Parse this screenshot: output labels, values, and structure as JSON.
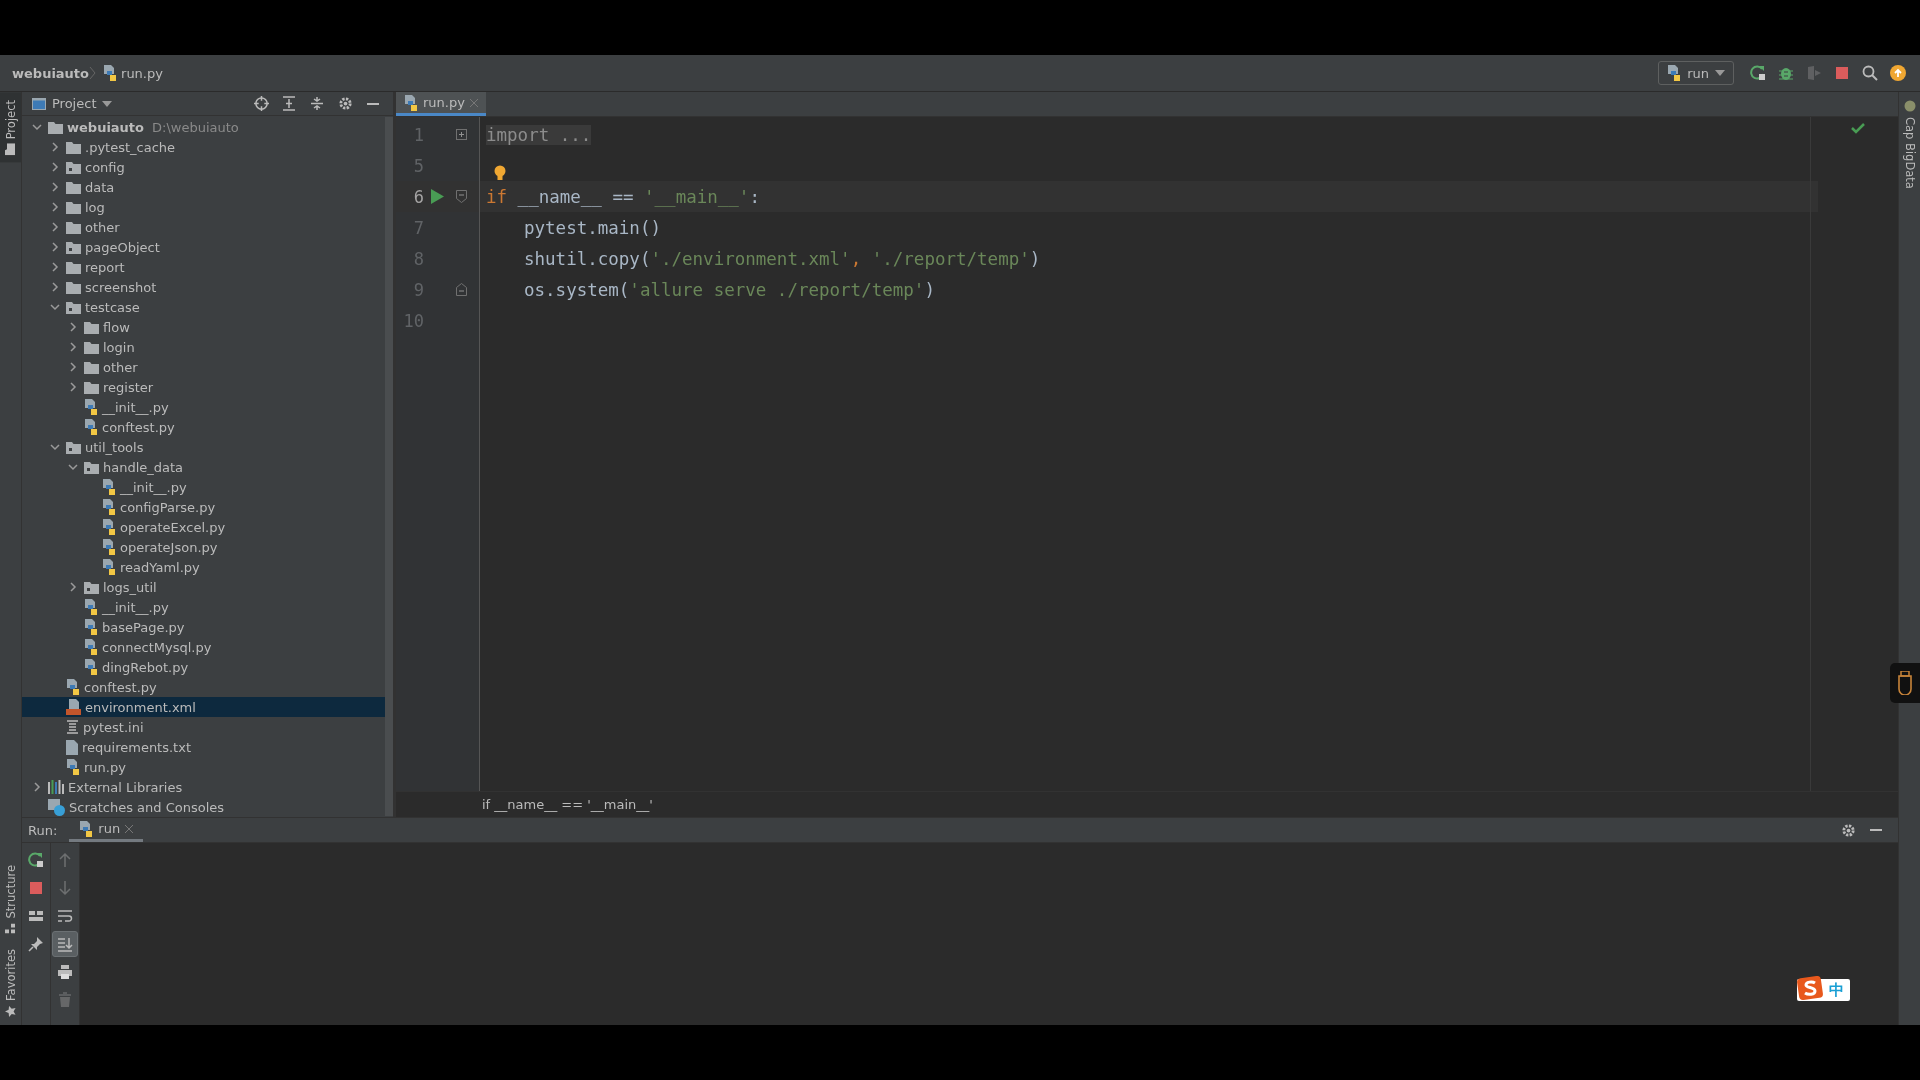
{
  "navbar": {
    "breadcrumb": [
      {
        "label": "webuiauto",
        "kind": "project"
      },
      {
        "label": "run.py",
        "kind": "python"
      }
    ],
    "run_config": "run",
    "actions": [
      {
        "kind": "rerun",
        "disabled": false
      },
      {
        "kind": "debug",
        "disabled": false
      },
      {
        "kind": "coverage",
        "disabled": true
      },
      {
        "kind": "stop",
        "disabled": false
      },
      {
        "kind": "search",
        "disabled": false
      },
      {
        "kind": "update",
        "disabled": false
      }
    ]
  },
  "left_stripe": {
    "top": [
      {
        "label": "Project",
        "selected": true
      }
    ],
    "bottom": [
      {
        "label": "Structure",
        "selected": false
      },
      {
        "label": "Favorites",
        "selected": false
      }
    ]
  },
  "project_panel": {
    "title": "Project",
    "tree": [
      {
        "label": "webuiauto",
        "kind": "folder",
        "expanded": true,
        "selected": false,
        "path": "D:\\webuiauto",
        "children": [
          {
            "label": ".pytest_cache",
            "kind": "folder",
            "expanded": false,
            "selected": false
          },
          {
            "label": "config",
            "kind": "package",
            "expanded": false,
            "selected": false
          },
          {
            "label": "data",
            "kind": "folder",
            "expanded": false,
            "selected": false
          },
          {
            "label": "log",
            "kind": "folder",
            "expanded": false,
            "selected": false
          },
          {
            "label": "other",
            "kind": "folder",
            "expanded": false,
            "selected": false
          },
          {
            "label": "pageObject",
            "kind": "package",
            "expanded": false,
            "selected": false
          },
          {
            "label": "report",
            "kind": "folder",
            "expanded": false,
            "selected": false
          },
          {
            "label": "screenshot",
            "kind": "folder",
            "expanded": false,
            "selected": false
          },
          {
            "label": "testcase",
            "kind": "package",
            "expanded": true,
            "selected": false,
            "children": [
              {
                "label": "flow",
                "kind": "folder",
                "expanded": false,
                "selected": false
              },
              {
                "label": "login",
                "kind": "folder",
                "expanded": false,
                "selected": false
              },
              {
                "label": "other",
                "kind": "folder",
                "expanded": false,
                "selected": false
              },
              {
                "label": "register",
                "kind": "folder",
                "expanded": false,
                "selected": false
              },
              {
                "label": "__init__.py",
                "kind": "python",
                "selected": false
              },
              {
                "label": "conftest.py",
                "kind": "python",
                "selected": false
              }
            ]
          },
          {
            "label": "util_tools",
            "kind": "package",
            "expanded": true,
            "selected": false,
            "children": [
              {
                "label": "handle_data",
                "kind": "package",
                "expanded": true,
                "selected": false,
                "children": [
                  {
                    "label": "__init__.py",
                    "kind": "python",
                    "selected": false
                  },
                  {
                    "label": "configParse.py",
                    "kind": "python",
                    "selected": false
                  },
                  {
                    "label": "operateExcel.py",
                    "kind": "python",
                    "selected": false
                  },
                  {
                    "label": "operateJson.py",
                    "kind": "python",
                    "selected": false
                  },
                  {
                    "label": "readYaml.py",
                    "kind": "python",
                    "selected": false
                  }
                ]
              },
              {
                "label": "logs_util",
                "kind": "package",
                "expanded": false,
                "selected": false
              },
              {
                "label": "__init__.py",
                "kind": "python",
                "selected": false
              },
              {
                "label": "basePage.py",
                "kind": "python",
                "selected": false
              },
              {
                "label": "connectMysql.py",
                "kind": "python",
                "selected": false
              },
              {
                "label": "dingRebot.py",
                "kind": "python",
                "selected": false
              }
            ]
          },
          {
            "label": "conftest.py",
            "kind": "python",
            "selected": false
          },
          {
            "label": "environment.xml",
            "kind": "xml",
            "selected": true
          },
          {
            "label": "pytest.ini",
            "kind": "ini",
            "selected": false
          },
          {
            "label": "requirements.txt",
            "kind": "txt",
            "selected": false
          },
          {
            "label": "run.py",
            "kind": "python",
            "selected": false
          }
        ]
      },
      {
        "label": "External Libraries",
        "kind": "libraries",
        "expanded": false,
        "selected": false
      },
      {
        "label": "Scratches and Consoles",
        "kind": "scratches",
        "selected": false
      }
    ]
  },
  "editor": {
    "tabs": [
      {
        "label": "run.py",
        "selected": true
      }
    ],
    "lines": [
      {
        "number": "1",
        "fold": {
          "kind": "expand"
        },
        "current": false,
        "tokens": [
          {
            "kind": "folded",
            "text": "import ..."
          }
        ]
      },
      {
        "number": "5",
        "bulb": true,
        "current": false
      },
      {
        "number": "6",
        "run": true,
        "fold": {
          "kind": "start"
        },
        "current": true,
        "tokens": [
          {
            "kind": "keyword",
            "text": "if"
          },
          {
            "kind": "plain",
            "text": " __name__ == "
          },
          {
            "kind": "string",
            "text": "'__main__'"
          },
          {
            "kind": "plain",
            "text": ":"
          }
        ]
      },
      {
        "number": "7",
        "indented": true,
        "current": false,
        "tokens": [
          {
            "kind": "plain",
            "text": "pytest.main()"
          }
        ]
      },
      {
        "number": "8",
        "indented": true,
        "current": false,
        "tokens": [
          {
            "kind": "plain",
            "text": "shutil.copy("
          },
          {
            "kind": "string",
            "text": "'./environment.xml'"
          },
          {
            "kind": "punct",
            "text": ", "
          },
          {
            "kind": "string",
            "text": "'./report/temp'"
          },
          {
            "kind": "plain",
            "text": ")"
          }
        ]
      },
      {
        "number": "9",
        "indented": true,
        "fold": {
          "kind": "end"
        },
        "current": false,
        "tokens": [
          {
            "kind": "plain",
            "text": "os.system("
          },
          {
            "kind": "string",
            "text": "'allure serve ./report/temp'"
          },
          {
            "kind": "plain",
            "text": ")"
          }
        ]
      },
      {
        "number": "10",
        "current": false
      }
    ],
    "breadcrumb": "if __name__ == '__main__'"
  },
  "right_stripe": [
    {
      "label": "Cap BigData",
      "selected": false
    }
  ],
  "run_panel": {
    "title": "Run:",
    "tabs": [
      {
        "label": "run",
        "selected": true
      }
    ],
    "actions": [
      {
        "kind": "rerun"
      },
      {
        "kind": "stop"
      },
      {
        "kind": "layout"
      },
      {
        "kind": "pin"
      }
    ],
    "console_actions": [
      {
        "kind": "up",
        "disabled": true,
        "selected": false
      },
      {
        "kind": "down",
        "disabled": true,
        "selected": false
      },
      {
        "kind": "wrap",
        "disabled": false,
        "selected": false
      },
      {
        "kind": "scroll-end",
        "disabled": false,
        "selected": true
      },
      {
        "kind": "print",
        "disabled": false,
        "selected": false
      },
      {
        "kind": "trash",
        "disabled": true,
        "selected": false
      }
    ]
  },
  "ime": {
    "label": "中"
  }
}
